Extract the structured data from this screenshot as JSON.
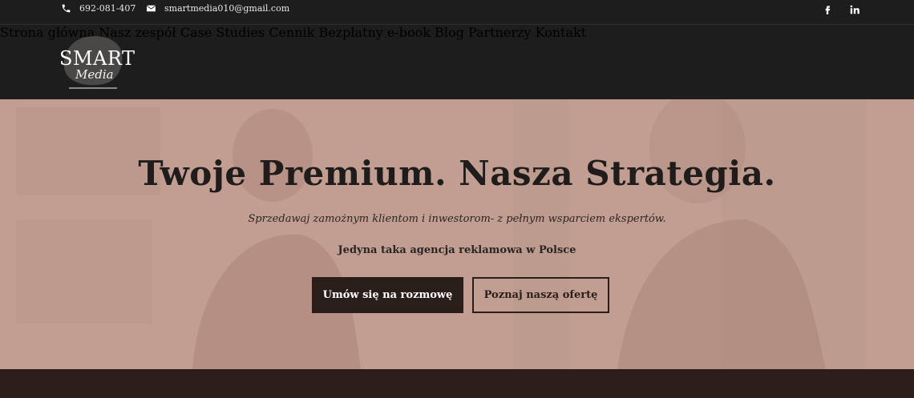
{
  "topbar": {
    "phone": "692-081-407",
    "email": "smartmedia010@gmail.com",
    "phone_icon": "phone-icon",
    "email_icon": "envelope-icon",
    "social": [
      "facebook-icon",
      "linkedin-icon"
    ]
  },
  "logo": {
    "word": "SMART",
    "script": "Media"
  },
  "nav": {
    "items": [
      {
        "label": "Strona główna"
      },
      {
        "label": "Nasz zespół"
      },
      {
        "label": "Case Studies"
      },
      {
        "label": "Cennik"
      },
      {
        "label": "Bezpłatny e-book"
      },
      {
        "label": "Blog"
      },
      {
        "label": "Partnerzy"
      },
      {
        "label": "Kontakt"
      }
    ]
  },
  "hero": {
    "title": "Twoje Premium. Nasza Strategia.",
    "subtitle": "Sprzedawaj zamożnym klientom i inwestorom- z pełnym wsparciem ekspertów.",
    "tagline": "Jedyna taka agencja reklamowa w Polsce",
    "primary_button": "Umów się na rozmowę",
    "secondary_button": "Poznaj naszą ofertę"
  },
  "colors": {
    "header_bg": "#1d1d1d",
    "hero_bg": "#c29e92",
    "button_dark": "#2a1e1b",
    "text_dark": "#1f1c1b"
  }
}
